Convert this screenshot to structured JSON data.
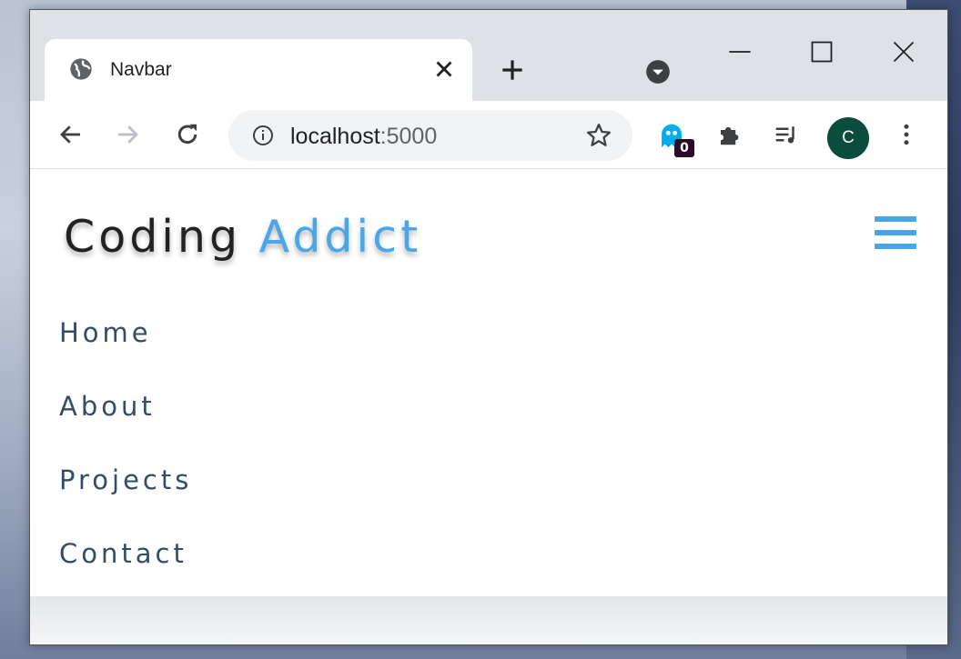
{
  "tab": {
    "title": "Navbar",
    "favicon": "globe-icon"
  },
  "window_controls": [
    "minimize-icon",
    "maximize-icon",
    "close-icon"
  ],
  "toolbar": {
    "url_host": "localhost",
    "url_port": ":5000",
    "extension_badge": "0",
    "profile_initial": "C",
    "icons": [
      "back-icon",
      "forward-icon",
      "reload-icon",
      "info-icon",
      "star-icon",
      "ghost-extension-icon",
      "puzzle-icon",
      "media-queue-icon",
      "kebab-menu-icon"
    ]
  },
  "page": {
    "brand": {
      "first": "Coding",
      "second": "Addict"
    },
    "nav": [
      "Home",
      "About",
      "Projects",
      "Contact"
    ]
  },
  "colors": {
    "accent": "#49a6e9",
    "nav_text": "#324d67",
    "avatar_bg": "#0b4d3c",
    "badge_bg": "#2a0a26"
  }
}
